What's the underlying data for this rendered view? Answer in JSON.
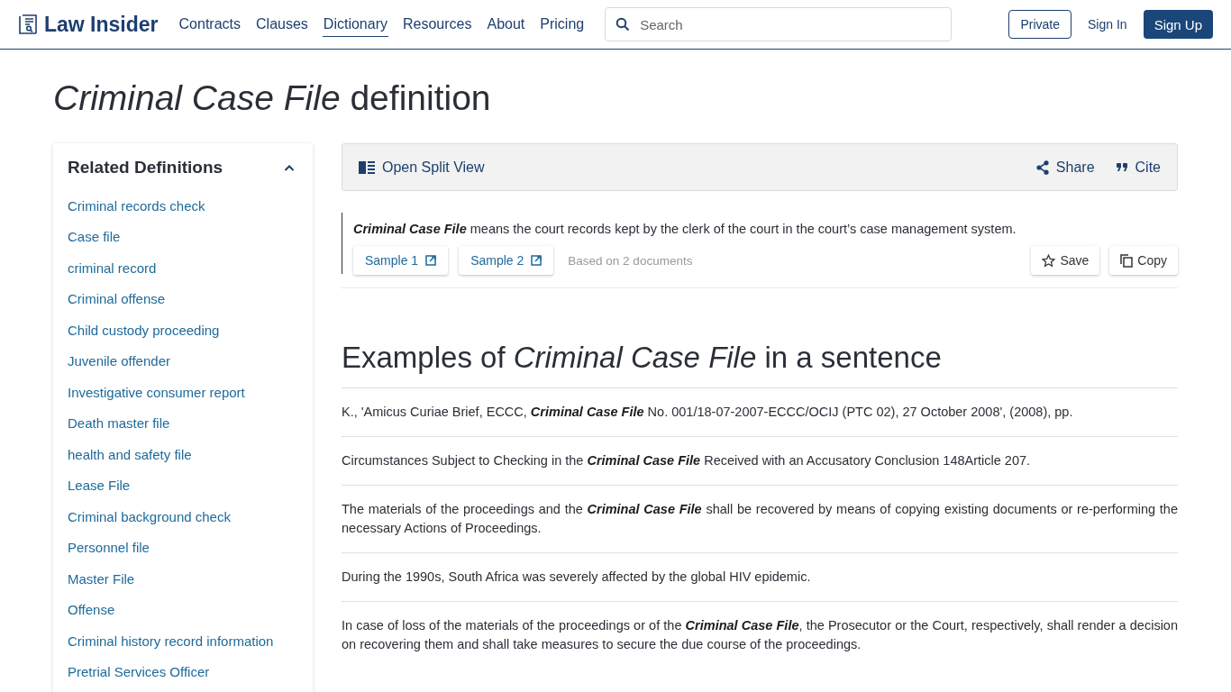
{
  "header": {
    "logo": "Law Insider",
    "nav": [
      {
        "label": "Contracts",
        "selected": false
      },
      {
        "label": "Clauses",
        "selected": false
      },
      {
        "label": "Dictionary",
        "selected": true
      },
      {
        "label": "Resources",
        "selected": false
      },
      {
        "label": "About",
        "selected": false
      },
      {
        "label": "Pricing",
        "selected": false
      }
    ],
    "search": {
      "placeholder": "Search"
    },
    "buttons": [
      {
        "label": "Private",
        "kind": "outline"
      },
      {
        "label": "Sign In",
        "kind": "text"
      },
      {
        "label": "Sign Up",
        "kind": "primary"
      }
    ]
  },
  "title": "*Criminal Case File* definition",
  "sidebar": {
    "heading": "Related Definitions",
    "expanded": true,
    "items": [
      "Criminal records check",
      "Case file",
      "criminal record",
      "Criminal offense",
      "Child custody proceeding",
      "Juvenile offender",
      "Investigative consumer report",
      "Death master file",
      "health and safety file",
      "Lease File",
      "Criminal background check",
      "Personnel file",
      "Master File",
      "Offense",
      "Criminal history record information",
      "Pretrial Services Officer"
    ]
  },
  "toolbar": {
    "split_view": "Open Split View",
    "share": "Share",
    "cite": "Cite"
  },
  "definition": {
    "text": "**Criminal Case File** means the court records kept by the clerk of the court in the court’s case management system.",
    "samples": [
      "Sample 1",
      "Sample 2"
    ],
    "source_note": "Based on 2 documents",
    "save": "Save",
    "copy": "Copy"
  },
  "examples": {
    "heading": "Examples of *Criminal Case File* in a sentence",
    "sentences": [
      "K., 'Amicus Curiae Brief, ECCC, **Criminal Case File** No. 001/18-07-2007-ECCC/OCIJ (PTC 02), 27 October 2008', (2008), pp.",
      "Circumstances Subject to Checking in the **Criminal Case File** Received with an Accusatory Conclusion 148Article 207.",
      "The materials of the proceedings and the **Criminal Case File** shall be recovered by means of copying existing documents or re-performing the necessary Actions of Proceedings.",
      "During the 1990s, South Africa was severely affected by the global HIV epidemic.",
      "In case of loss of the materials of the proceedings or of the **Criminal Case File**, the Prosecutor or the Court, respectively, shall render a decision on recovering them and shall take measures to secure the due course of the proceedings."
    ]
  }
}
